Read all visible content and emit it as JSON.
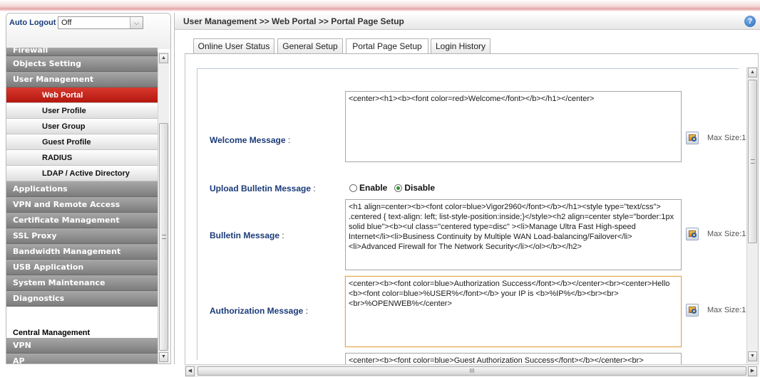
{
  "sidebar": {
    "auto_logout_label": "Auto Logout",
    "auto_logout_value": "Off",
    "partial_item": "Firewall",
    "items": [
      {
        "label": "Objects Setting"
      },
      {
        "label": "User Management"
      },
      {
        "label": "Web Portal"
      },
      {
        "label": "User Profile"
      },
      {
        "label": "User Group"
      },
      {
        "label": "Guest Profile"
      },
      {
        "label": "RADIUS"
      },
      {
        "label": "LDAP / Active Directory"
      },
      {
        "label": "Applications"
      },
      {
        "label": "VPN and Remote Access"
      },
      {
        "label": "Certificate Management"
      },
      {
        "label": "SSL Proxy"
      },
      {
        "label": "Bandwidth Management"
      },
      {
        "label": "USB Application"
      },
      {
        "label": "System Maintenance"
      },
      {
        "label": "Diagnostics"
      }
    ],
    "central_management": "Central Management",
    "central_items": [
      {
        "label": "VPN"
      },
      {
        "label": "AP"
      }
    ]
  },
  "header": {
    "breadcrumb": "User Management >> Web Portal >> Portal Page Setup",
    "help": "?"
  },
  "tabs": [
    {
      "label": "Online User Status"
    },
    {
      "label": "General Setup"
    },
    {
      "label": "Portal Page Setup"
    },
    {
      "label": "Login History"
    }
  ],
  "active_tab": "Portal Page Setup",
  "form": {
    "welcome": {
      "label": "Welcome Message",
      "value": "<center><h1><b><font color=red>Welcome</font></b></h1></center>",
      "max": "Max Size:1"
    },
    "upload_bulletin": {
      "label": "Upload Bulletin Message",
      "enable": "Enable",
      "disable": "Disable",
      "selected": "Disable"
    },
    "bulletin": {
      "label": "Bulletin Message",
      "value": "<h1 align=center><b><font color=blue>Vigor2960</font></b></h1><style type=\"text/css\"> .centered { text-align: left; list-style-position:inside;}</style><h2 align=center style=\"border:1px solid blue\"><b><ul class=\"centered type=disc\" ><li>Manage Ultra Fast High-speed Internet</li><li>Business Continuity by Multiple WAN Load-balancing/Failover</li><li>Advanced Firewall for The Network Security</li></ol></b></h2>",
      "max": "Max Size:1"
    },
    "authorization": {
      "label": "Authorization Message",
      "value": "<center><b><font color=blue>Authorization Success</font></b></center><br><center>Hello <b><font color=blue>%USER%</font></b> your IP is <b>%IP%</b><br><br><br>%OPENWEB%</center>",
      "max": "Max Size:1"
    },
    "guest_authorization": {
      "value": "<center><b><font color=blue>Guest Authorization Success</font></b></center><br>"
    },
    "colon": ":"
  },
  "scroll": {
    "up": "▲",
    "down": "▼",
    "left": "◀",
    "right": "▶",
    "thumb_mark": "III"
  },
  "icons": [
    "chevron-down-icon",
    "help-icon",
    "preview-icon"
  ],
  "colors": {
    "active_menu": "#c8231a",
    "label_blue": "#1b3b78",
    "focus_border": "#e3a64b"
  }
}
